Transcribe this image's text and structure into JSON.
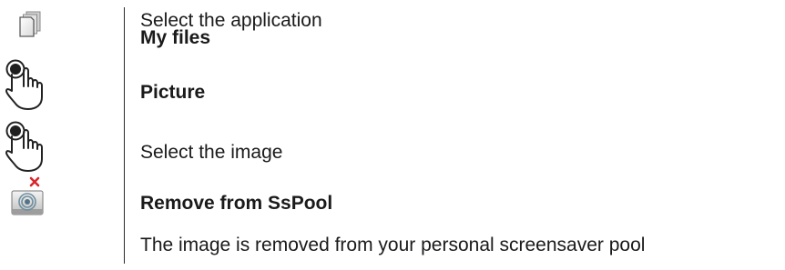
{
  "steps": [
    {
      "icon": "files-app-icon",
      "lines": [
        "Select the application",
        "My files"
      ]
    },
    {
      "icon": "tap-hand-icon",
      "lines": [
        "Picture"
      ]
    },
    {
      "icon": "tap-hand-icon",
      "lines": [
        "Select the image"
      ]
    },
    {
      "icon": "remove-screensaver-icon",
      "lines": [
        "Remove from SsPool"
      ]
    },
    {
      "icon": null,
      "lines": [
        "The image is removed from your personal screensaver pool"
      ]
    }
  ]
}
